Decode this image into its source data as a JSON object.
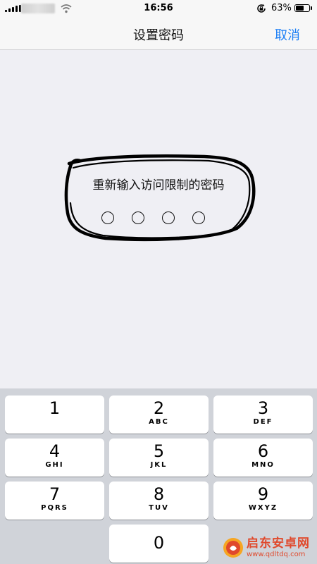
{
  "status_bar": {
    "time": "16:56",
    "battery_percent_label": "63%",
    "battery_level": 0.63
  },
  "nav": {
    "title": "设置密码",
    "cancel_label": "取消"
  },
  "prompt": {
    "text": "重新输入访问限制的密码",
    "passcode_length": 4
  },
  "keypad": {
    "keys": [
      {
        "number": "1",
        "letters": ""
      },
      {
        "number": "2",
        "letters": "ABC"
      },
      {
        "number": "3",
        "letters": "DEF"
      },
      {
        "number": "4",
        "letters": "GHI"
      },
      {
        "number": "5",
        "letters": "JKL"
      },
      {
        "number": "6",
        "letters": "MNO"
      },
      {
        "number": "7",
        "letters": "PQRS"
      },
      {
        "number": "8",
        "letters": "TUV"
      },
      {
        "number": "9",
        "letters": "WXYZ"
      },
      {
        "number": "0",
        "letters": ""
      }
    ]
  },
  "watermark": {
    "name": "启东安卓网",
    "url": "www.qdltdq.com"
  },
  "colors": {
    "accent": "#1a7ef5",
    "background": "#efeff4",
    "keypad_background": "#d0d3d9",
    "watermark": "#e0492c"
  }
}
